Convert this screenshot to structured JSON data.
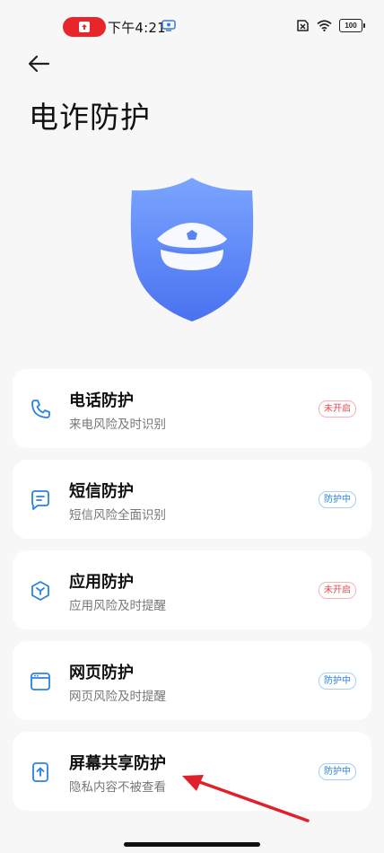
{
  "status_bar": {
    "time": "下午4:21",
    "battery": "100"
  },
  "page": {
    "title": "电诈防护"
  },
  "cards": [
    {
      "title": "电话防护",
      "subtitle": "来电风险及时识别",
      "status": "未开启",
      "icon": "phone-icon"
    },
    {
      "title": "短信防护",
      "subtitle": "短信风险全面识别",
      "status": "防护中",
      "icon": "message-icon"
    },
    {
      "title": "应用防护",
      "subtitle": "应用风险及时提醒",
      "status": "未开启",
      "icon": "app-cube-icon"
    },
    {
      "title": "网页防护",
      "subtitle": "网页风险及时提醒",
      "status": "防护中",
      "icon": "browser-icon"
    },
    {
      "title": "屏幕共享防护",
      "subtitle": "隐私内容不被查看",
      "status": "防护中",
      "icon": "screen-share-icon"
    }
  ],
  "colors": {
    "accent_blue": "#2a82e4",
    "off_red": "#e5484d",
    "shield_top": "#6e9cff",
    "shield_bottom": "#4a74f2"
  }
}
